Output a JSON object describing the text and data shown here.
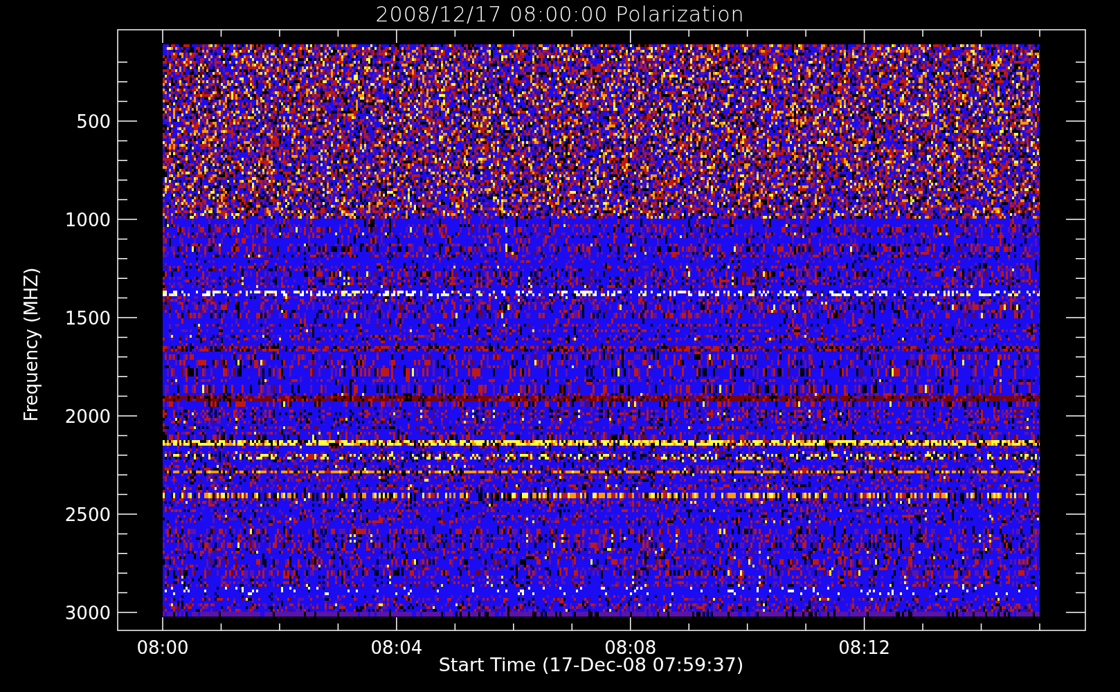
{
  "title": "2008/12/17 08:00:00 Polarization",
  "y_axis": {
    "label": "Frequency (MHZ)",
    "ticks": [
      "500",
      "1000",
      "1500",
      "2000",
      "2500",
      "3000"
    ]
  },
  "x_axis": {
    "label": "Start Time (17-Dec-08 07:59:37)",
    "ticks": [
      "08:00",
      "08:04",
      "08:08",
      "08:12"
    ]
  }
}
